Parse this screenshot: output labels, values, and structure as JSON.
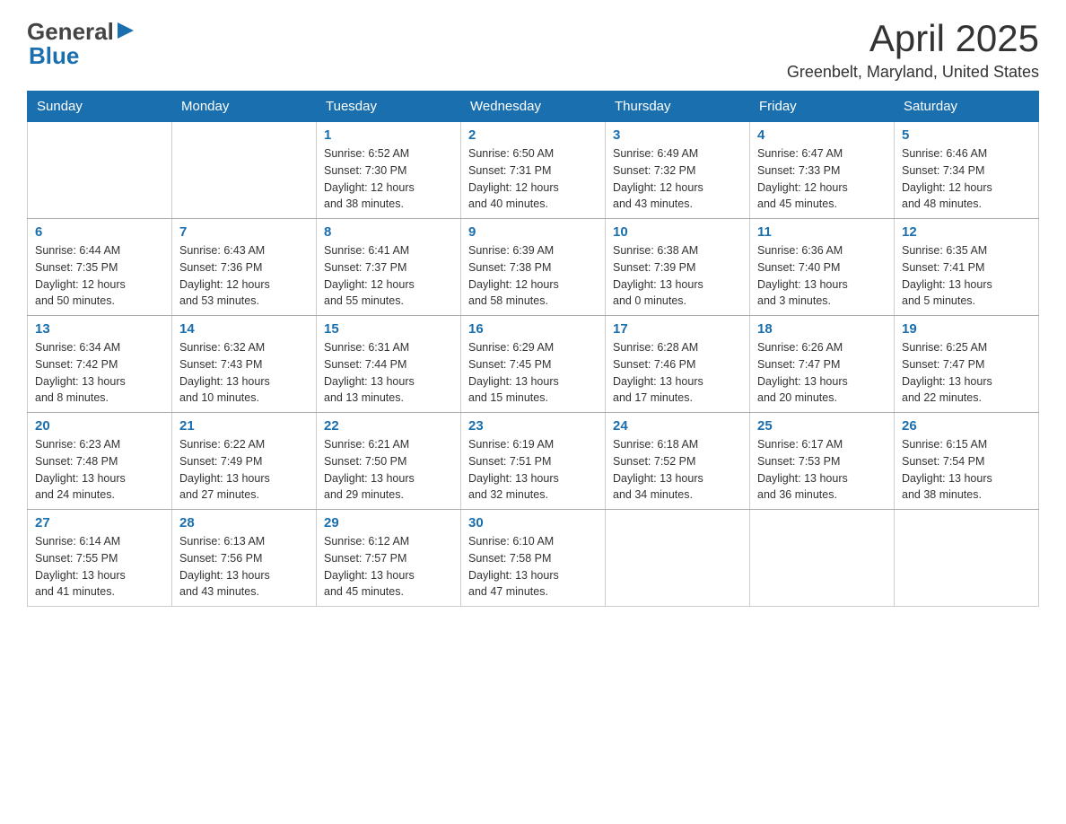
{
  "header": {
    "logo_general": "General",
    "logo_blue": "Blue",
    "title": "April 2025",
    "subtitle": "Greenbelt, Maryland, United States"
  },
  "calendar": {
    "days_of_week": [
      "Sunday",
      "Monday",
      "Tuesday",
      "Wednesday",
      "Thursday",
      "Friday",
      "Saturday"
    ],
    "weeks": [
      [
        {
          "day": "",
          "info": ""
        },
        {
          "day": "",
          "info": ""
        },
        {
          "day": "1",
          "info": "Sunrise: 6:52 AM\nSunset: 7:30 PM\nDaylight: 12 hours\nand 38 minutes."
        },
        {
          "day": "2",
          "info": "Sunrise: 6:50 AM\nSunset: 7:31 PM\nDaylight: 12 hours\nand 40 minutes."
        },
        {
          "day": "3",
          "info": "Sunrise: 6:49 AM\nSunset: 7:32 PM\nDaylight: 12 hours\nand 43 minutes."
        },
        {
          "day": "4",
          "info": "Sunrise: 6:47 AM\nSunset: 7:33 PM\nDaylight: 12 hours\nand 45 minutes."
        },
        {
          "day": "5",
          "info": "Sunrise: 6:46 AM\nSunset: 7:34 PM\nDaylight: 12 hours\nand 48 minutes."
        }
      ],
      [
        {
          "day": "6",
          "info": "Sunrise: 6:44 AM\nSunset: 7:35 PM\nDaylight: 12 hours\nand 50 minutes."
        },
        {
          "day": "7",
          "info": "Sunrise: 6:43 AM\nSunset: 7:36 PM\nDaylight: 12 hours\nand 53 minutes."
        },
        {
          "day": "8",
          "info": "Sunrise: 6:41 AM\nSunset: 7:37 PM\nDaylight: 12 hours\nand 55 minutes."
        },
        {
          "day": "9",
          "info": "Sunrise: 6:39 AM\nSunset: 7:38 PM\nDaylight: 12 hours\nand 58 minutes."
        },
        {
          "day": "10",
          "info": "Sunrise: 6:38 AM\nSunset: 7:39 PM\nDaylight: 13 hours\nand 0 minutes."
        },
        {
          "day": "11",
          "info": "Sunrise: 6:36 AM\nSunset: 7:40 PM\nDaylight: 13 hours\nand 3 minutes."
        },
        {
          "day": "12",
          "info": "Sunrise: 6:35 AM\nSunset: 7:41 PM\nDaylight: 13 hours\nand 5 minutes."
        }
      ],
      [
        {
          "day": "13",
          "info": "Sunrise: 6:34 AM\nSunset: 7:42 PM\nDaylight: 13 hours\nand 8 minutes."
        },
        {
          "day": "14",
          "info": "Sunrise: 6:32 AM\nSunset: 7:43 PM\nDaylight: 13 hours\nand 10 minutes."
        },
        {
          "day": "15",
          "info": "Sunrise: 6:31 AM\nSunset: 7:44 PM\nDaylight: 13 hours\nand 13 minutes."
        },
        {
          "day": "16",
          "info": "Sunrise: 6:29 AM\nSunset: 7:45 PM\nDaylight: 13 hours\nand 15 minutes."
        },
        {
          "day": "17",
          "info": "Sunrise: 6:28 AM\nSunset: 7:46 PM\nDaylight: 13 hours\nand 17 minutes."
        },
        {
          "day": "18",
          "info": "Sunrise: 6:26 AM\nSunset: 7:47 PM\nDaylight: 13 hours\nand 20 minutes."
        },
        {
          "day": "19",
          "info": "Sunrise: 6:25 AM\nSunset: 7:47 PM\nDaylight: 13 hours\nand 22 minutes."
        }
      ],
      [
        {
          "day": "20",
          "info": "Sunrise: 6:23 AM\nSunset: 7:48 PM\nDaylight: 13 hours\nand 24 minutes."
        },
        {
          "day": "21",
          "info": "Sunrise: 6:22 AM\nSunset: 7:49 PM\nDaylight: 13 hours\nand 27 minutes."
        },
        {
          "day": "22",
          "info": "Sunrise: 6:21 AM\nSunset: 7:50 PM\nDaylight: 13 hours\nand 29 minutes."
        },
        {
          "day": "23",
          "info": "Sunrise: 6:19 AM\nSunset: 7:51 PM\nDaylight: 13 hours\nand 32 minutes."
        },
        {
          "day": "24",
          "info": "Sunrise: 6:18 AM\nSunset: 7:52 PM\nDaylight: 13 hours\nand 34 minutes."
        },
        {
          "day": "25",
          "info": "Sunrise: 6:17 AM\nSunset: 7:53 PM\nDaylight: 13 hours\nand 36 minutes."
        },
        {
          "day": "26",
          "info": "Sunrise: 6:15 AM\nSunset: 7:54 PM\nDaylight: 13 hours\nand 38 minutes."
        }
      ],
      [
        {
          "day": "27",
          "info": "Sunrise: 6:14 AM\nSunset: 7:55 PM\nDaylight: 13 hours\nand 41 minutes."
        },
        {
          "day": "28",
          "info": "Sunrise: 6:13 AM\nSunset: 7:56 PM\nDaylight: 13 hours\nand 43 minutes."
        },
        {
          "day": "29",
          "info": "Sunrise: 6:12 AM\nSunset: 7:57 PM\nDaylight: 13 hours\nand 45 minutes."
        },
        {
          "day": "30",
          "info": "Sunrise: 6:10 AM\nSunset: 7:58 PM\nDaylight: 13 hours\nand 47 minutes."
        },
        {
          "day": "",
          "info": ""
        },
        {
          "day": "",
          "info": ""
        },
        {
          "day": "",
          "info": ""
        }
      ]
    ]
  }
}
